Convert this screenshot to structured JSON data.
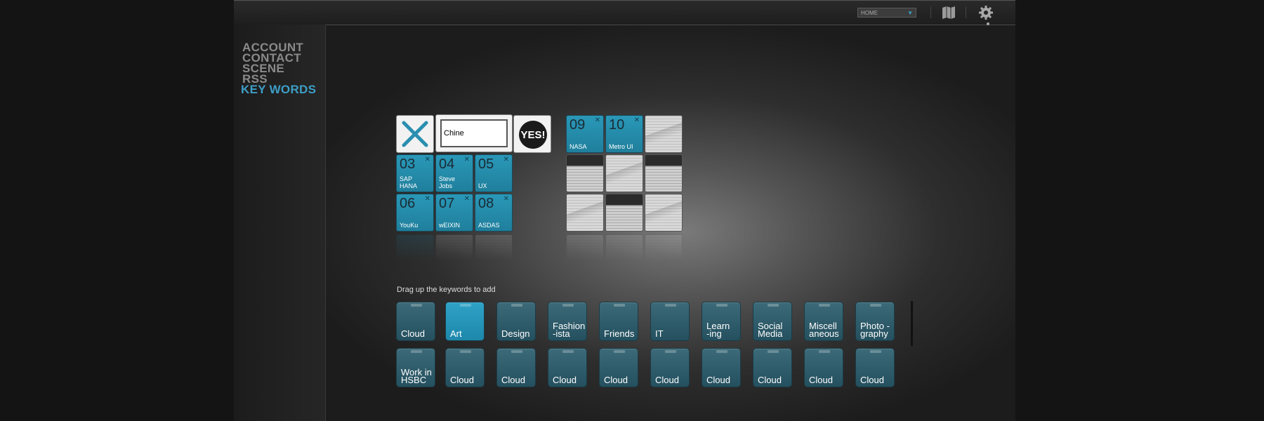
{
  "topbar": {
    "home_select": "HOME"
  },
  "sidebar": {
    "items": [
      {
        "label": "ACCOUNT"
      },
      {
        "label": "CONTACT"
      },
      {
        "label": "SCENE"
      },
      {
        "label": "RSS"
      },
      {
        "label": "KEY WORDS",
        "active": true
      }
    ]
  },
  "editor": {
    "search_value": "Chine",
    "yes_label": "YES!"
  },
  "left_tiles": [
    {
      "num": "03",
      "label": "SAP HANA"
    },
    {
      "num": "04",
      "label": "Steve Jobs"
    },
    {
      "num": "05",
      "label": "UX"
    },
    {
      "num": "06",
      "label": "YouKu"
    },
    {
      "num": "07",
      "label": "wEIXIN"
    },
    {
      "num": "08",
      "label": "ASDAS"
    }
  ],
  "right_tiles": [
    {
      "num": "09",
      "label": "NASA"
    },
    {
      "num": "10",
      "label": "Metro UI"
    }
  ],
  "keyword_hint": "Drag up the keywords to add",
  "keywords_row1": [
    {
      "label": "Cloud"
    },
    {
      "label": "Art",
      "active": true
    },
    {
      "label": "Design"
    },
    {
      "label": "Fashion -ista"
    },
    {
      "label": "Friends"
    },
    {
      "label": "IT"
    },
    {
      "label": "Learn -ing"
    },
    {
      "label": "Social Media"
    },
    {
      "label": "Miscell aneous"
    },
    {
      "label": "Photo -graphy"
    }
  ],
  "keywords_row2": [
    {
      "label": "Work in HSBC"
    },
    {
      "label": "Cloud"
    },
    {
      "label": "Cloud"
    },
    {
      "label": "Cloud"
    },
    {
      "label": "Cloud"
    },
    {
      "label": "Cloud"
    },
    {
      "label": "Cloud"
    },
    {
      "label": "Cloud"
    },
    {
      "label": "Cloud"
    },
    {
      "label": "Cloud"
    }
  ],
  "colors": {
    "accent": "#3d9ec6",
    "tile_blue": "#2a98b8",
    "keyword_tile": "#2e5e6c"
  }
}
